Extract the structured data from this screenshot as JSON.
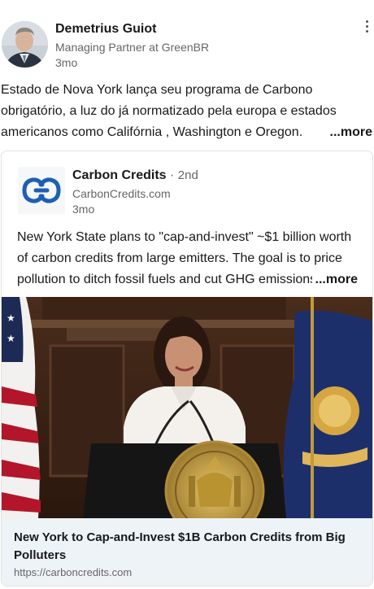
{
  "post": {
    "author_name": "Demetrius Guiot",
    "author_title": "Managing Partner at GreenBR",
    "time": "3mo",
    "text": "Estado de Nova York lança seu programa de Carbono obrigatório, a luz do já normatizado pela europa e estados americanos como Califórnia , Washington e Oregon.",
    "more_label": "...more"
  },
  "shared": {
    "author_name": "Carbon Credits",
    "separator": " · ",
    "time": "2nd",
    "domain": "CarbonCredits.com",
    "age": "3mo",
    "text": "New York State plans to \"cap-and-invest\" ~$1 billion worth of carbon credits from large emitters. The goal is to price pollution to ditch fossil fuels and cut GHG emissions.",
    "more_label": "...more"
  },
  "article": {
    "title": "New York to Cap-and-Invest $1B Carbon Credits from Big Polluters",
    "url": "https://carboncredits.com"
  },
  "colors": {
    "logo_blue": "#1e5fb4",
    "footer_bg": "#eef3f8",
    "muted_text": "#666666"
  },
  "icons": {
    "menu": "more-vertical-icon",
    "logo": "carbon-credits-logo"
  }
}
